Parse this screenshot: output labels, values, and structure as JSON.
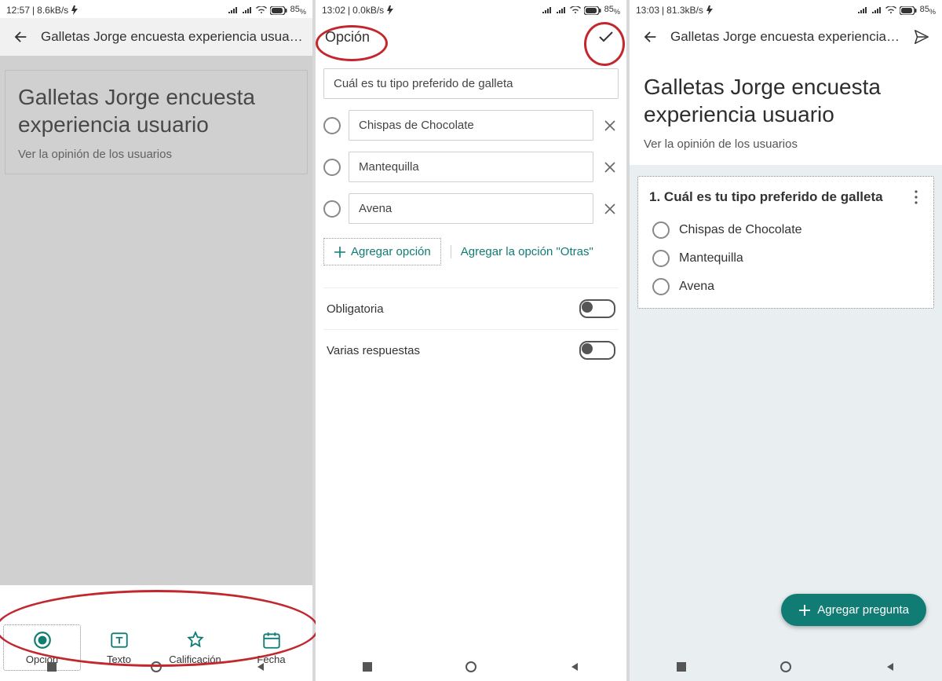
{
  "status": {
    "battery": "85",
    "battery_suffix": "%"
  },
  "panels": {
    "p1": {
      "status_time": "12:57",
      "status_rate": "8.6kB/s",
      "appbar_title": "Galletas Jorge encuesta experiencia usuar...",
      "card_title": "Galletas Jorge encuesta experiencia usuario",
      "card_sub": "Ver la opinión de los usuarios",
      "sheet": {
        "item0": "Opción",
        "item1": "Texto",
        "item2": "Calificación",
        "item3": "Fecha"
      }
    },
    "p2": {
      "status_time": "13:02",
      "status_rate": "0.0kB/s",
      "appbar_title": "Opción",
      "question": "Cuál es tu tipo preferido de galleta",
      "opt0": "Chispas de Chocolate",
      "opt1": "Mantequilla",
      "opt2": "Avena",
      "add_option": "Agregar opción",
      "add_other": "Agregar la opción \"Otras\"",
      "toggle0": "Obligatoria",
      "toggle1": "Varias respuestas"
    },
    "p3": {
      "status_time": "13:03",
      "status_rate": "81.3kB/s",
      "appbar_title": "Galletas Jorge encuesta experiencia u...",
      "card_title": "Galletas Jorge encuesta experiencia usuario",
      "card_sub": "Ver la opinión de los usuarios",
      "q_number": "1.",
      "q_title": "Cuál es tu tipo preferido de galleta",
      "opt0": "Chispas de Chocolate",
      "opt1": "Mantequilla",
      "opt2": "Avena",
      "fab": "Agregar pregunta"
    }
  }
}
